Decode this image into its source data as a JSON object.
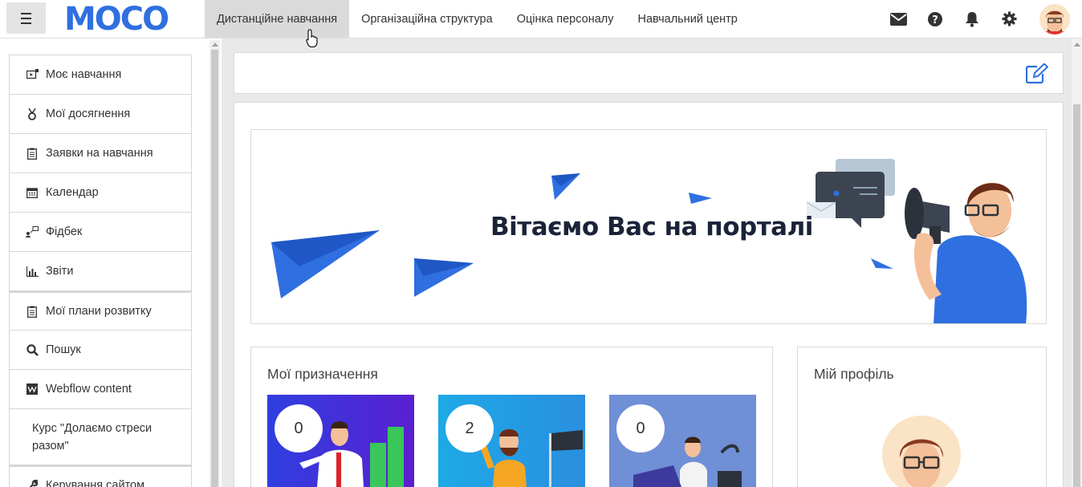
{
  "header": {
    "logo_text": "MOCO",
    "nav": [
      {
        "label": "Дистанційне навчання"
      },
      {
        "label": "Організаційна структура"
      },
      {
        "label": "Оцінка персоналу"
      },
      {
        "label": "Навчальний центр"
      }
    ],
    "icons": [
      "envelope-icon",
      "question-icon",
      "bell-icon",
      "gear-icon",
      "avatar"
    ]
  },
  "sidebar": {
    "items": [
      {
        "label": "Моє навчання",
        "icon": "play-screen-icon"
      },
      {
        "label": "Мої досягнення",
        "icon": "medal-icon"
      },
      {
        "label": "Заявки на навчання",
        "icon": "clipboard-icon"
      },
      {
        "label": "Календар",
        "icon": "calendar-icon"
      },
      {
        "label": "Фідбек",
        "icon": "feedback-icon"
      },
      {
        "label": "Звіти",
        "icon": "chart-icon"
      },
      {
        "label": "Мої плани розвитку",
        "icon": "clipboard-icon"
      },
      {
        "label": "Пошук",
        "icon": "search-icon"
      },
      {
        "label": "Webflow content",
        "icon": "webflow-icon"
      },
      {
        "label": "Курс \"Долаємо стреси разом\"",
        "icon": ""
      },
      {
        "label": "Керування сайтом",
        "icon": "wrench-icon"
      }
    ]
  },
  "banner": {
    "title": "Вітаємо Вас на порталі"
  },
  "assignments": {
    "title": "Мої призначення",
    "items": [
      {
        "count": "0",
        "bg": "#3b2fd6"
      },
      {
        "count": "2",
        "bg": "#25b2e8"
      },
      {
        "count": "0",
        "bg": "#6f8fd6"
      }
    ]
  },
  "profile": {
    "title": "Мій профіль"
  },
  "colors": {
    "brand_blue": "#2f6fe0",
    "banner_title": "#1a2338"
  }
}
